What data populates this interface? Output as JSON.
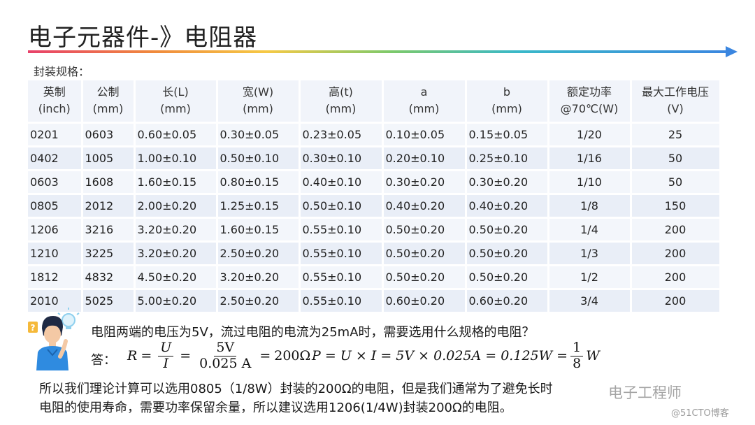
{
  "title": "电子元器件-》电阻器",
  "section_label": "封装规格：",
  "table": {
    "headers": [
      [
        "英制",
        "(inch)"
      ],
      [
        "公制",
        "(mm)"
      ],
      [
        "长(L)",
        "(mm)"
      ],
      [
        "宽(W)",
        "(mm)"
      ],
      [
        "高(t)",
        "(mm)"
      ],
      [
        "a",
        "(mm)"
      ],
      [
        "b",
        "(mm)"
      ],
      [
        "额定功率",
        "@70℃(W)"
      ],
      [
        "最大工作电压",
        "(V)"
      ]
    ],
    "rows": [
      [
        "0201",
        "0603",
        "0.60±0.05",
        "0.30±0.05",
        "0.23±0.05",
        "0.10±0.05",
        "0.15±0.05",
        "1/20",
        "25"
      ],
      [
        "0402",
        "1005",
        "1.00±0.10",
        "0.50±0.10",
        "0.30±0.10",
        "0.20±0.10",
        "0.25±0.10",
        "1/16",
        "50"
      ],
      [
        "0603",
        "1608",
        "1.60±0.15",
        "0.80±0.15",
        "0.40±0.10",
        "0.30±0.20",
        "0.30±0.20",
        "1/10",
        "50"
      ],
      [
        "0805",
        "2012",
        "2.00±0.20",
        "1.25±0.15",
        "0.50±0.10",
        "0.40±0.20",
        "0.40±0.20",
        "1/8",
        "150"
      ],
      [
        "1206",
        "3216",
        "3.20±0.20",
        "1.60±0.15",
        "0.55±0.10",
        "0.50±0.20",
        "0.50±0.20",
        "1/4",
        "200"
      ],
      [
        "1210",
        "3225",
        "3.20±0.20",
        "2.50±0.20",
        "0.55±0.10",
        "0.50±0.20",
        "0.50±0.20",
        "1/3",
        "200"
      ],
      [
        "1812",
        "4832",
        "4.50±0.20",
        "3.20±0.20",
        "0.55±0.10",
        "0.50±0.20",
        "0.50±0.20",
        "1/2",
        "200"
      ],
      [
        "2010",
        "5025",
        "5.00±0.20",
        "2.50±0.20",
        "0.55±0.10",
        "0.60±0.20",
        "0.60±0.20",
        "3/4",
        "200"
      ]
    ]
  },
  "question": "电阻两端的电压为5V，流过电阻的电流为25mA时，需要选用什么规格的电阻？",
  "answer_label": "答：",
  "formula1": {
    "lhs": "R",
    "eq": "=",
    "frac1_num": "U",
    "frac1_den": "I",
    "frac2_num": "5V",
    "frac2_den": "0.025 A",
    "result": "200Ω"
  },
  "formula2": {
    "expr": "P = U × I = 5V × 0.025A = 0.125W =",
    "frac_num": "1",
    "frac_den": "8",
    "unit": "W"
  },
  "conclusion_line1": "所以我们理论计算可以选用0805（1/8W）封装的200Ω的电阻，但是我们通常为了避免长时",
  "conclusion_line2": "电阻的使用寿命，需要功率保留余量，所以建议选用1206(1/4W)封装200Ω的电阻。",
  "watermark": "电子工程师",
  "watermark_site": "@51CTO博客",
  "icon": "thinking-person-lightbulb-icon",
  "colors": {
    "accent_arrow": "#3a86e0",
    "table_header": "#f1f4fa",
    "table_row": "#f3f6fb",
    "table_row_alt": "#e9eef7"
  }
}
